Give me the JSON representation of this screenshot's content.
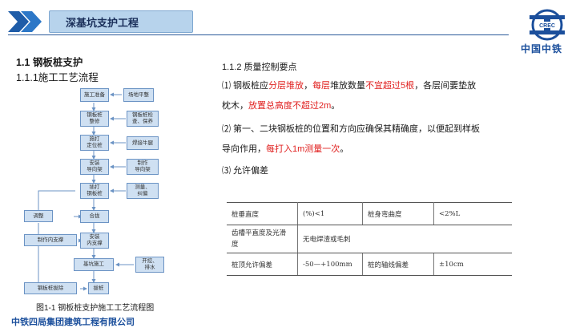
{
  "header": {
    "title": "深基坑支护工程"
  },
  "logo": {
    "text": "中国中铁"
  },
  "section": {
    "title": "1.1 钢板桩支护",
    "subtitle": "1.1.1施工工艺流程"
  },
  "flowchart": {
    "nodes": {
      "prep": "施工准备",
      "level": "场地平整",
      "pile_inspect": "钢板桩\n整修",
      "pile_store": "钢板桩检\n查、保养",
      "position": "施打\n定位桩",
      "weld": "焊接牛腿",
      "install_guide": "安装\n导向架",
      "make_guide": "制作\n导向架",
      "drive": "插打\n钢板桩",
      "survey": "测量、\n纠偏",
      "adjust": "调整",
      "close": "合拢",
      "make_brace": "制作内支撑",
      "install_brace": "安装\n内支撑",
      "excavate": "基坑施工",
      "dewater": "开挖、\n排水",
      "pull": "钢板桩拔除",
      "pull2": "拔桩"
    },
    "caption": "图1-1 钢板桩支护施工工艺流程图"
  },
  "quality": {
    "heading": "1.1.2 质量控制要点",
    "p1": {
      "a": "⑴ 钢板桩应",
      "b": "分层堆放",
      "c": "，",
      "d": "每层",
      "e": "堆放数量",
      "f": "不宜超过5根",
      "g": "，各层间要垫放",
      "h": "枕木，",
      "i": "放置总高度不超过2m",
      "j": "。"
    },
    "p2": {
      "a": "⑵ 第一、二块钢板桩的位置和方向应确保其精确度，以便起到样板",
      "b": "导向作用，",
      "c": "每打入1m测量一次",
      "d": "。"
    },
    "p3": "⑶ 允许偏差"
  },
  "tolerance_table": {
    "r1": [
      "桩垂直度",
      "(%)<1",
      "桩身弯曲度",
      "<2%L"
    ],
    "r2": [
      "齿槽平直度及光滑度",
      "无电焊渣或毛刺"
    ],
    "r3": [
      "桩顶允许偏差",
      "-50—+100mm",
      "桩的轴线偏差",
      "±10cm"
    ]
  },
  "footer": {
    "company": "中铁四局集团建筑工程有限公司"
  },
  "colors": {
    "accent": "#1b4f9c",
    "highlight_red": "#e0201f",
    "title_bar": "#b7d3ec",
    "flow_box": "#cfe0f2"
  }
}
